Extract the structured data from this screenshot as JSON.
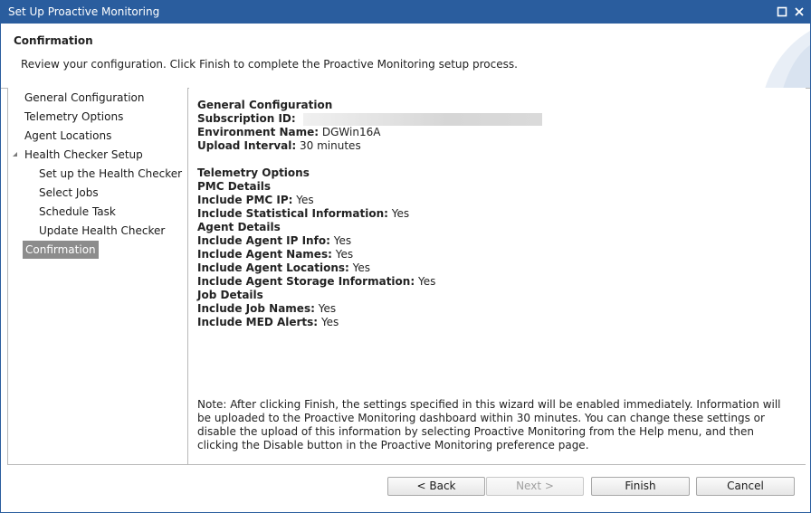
{
  "window": {
    "title": "Set Up Proactive Monitoring",
    "maximize_icon": "maximize-icon",
    "close_icon": "close-icon"
  },
  "header": {
    "heading": "Confirmation",
    "description": "Review your configuration. Click Finish to complete the Proactive Monitoring setup process."
  },
  "nav": {
    "items": [
      {
        "label": "General Configuration"
      },
      {
        "label": "Telemetry Options"
      },
      {
        "label": "Agent Locations"
      },
      {
        "label": "Health Checker Setup"
      },
      {
        "label": "Set up the Health Checker"
      },
      {
        "label": "Select Jobs"
      },
      {
        "label": "Schedule Task"
      },
      {
        "label": "Update Health Checker"
      },
      {
        "label": "Confirmation"
      }
    ],
    "expand_icon": "tree-expanded-arrow-icon"
  },
  "summary": {
    "general_heading": "General Configuration",
    "subscription_label": "Subscription ID:",
    "subscription_value": "",
    "environment_label": "Environment Name:",
    "environment_value": "DGWin16A",
    "upload_label": "Upload Interval:",
    "upload_value": "30 minutes",
    "telemetry_heading": "Telemetry Options",
    "pmc_heading": "PMC Details",
    "pmc_ip_label": "Include PMC IP:",
    "pmc_ip_value": "Yes",
    "stat_label": "Include Statistical Information:",
    "stat_value": "Yes",
    "agent_heading": "Agent Details",
    "agent_ip_label": "Include Agent IP Info:",
    "agent_ip_value": "Yes",
    "agent_names_label": "Include Agent Names:",
    "agent_names_value": "Yes",
    "agent_locations_label": "Include Agent Locations:",
    "agent_locations_value": "Yes",
    "agent_storage_label": "Include Agent Storage Information:",
    "agent_storage_value": "Yes",
    "job_heading": "Job Details",
    "job_names_label": "Include Job Names:",
    "job_names_value": "Yes",
    "med_alerts_label": "Include MED Alerts:",
    "med_alerts_value": "Yes"
  },
  "note": {
    "lines": [
      "Note: After clicking Finish, the settings specified in this wizard will be enabled immediately. Information will",
      "be uploaded to the Proactive Monitoring dashboard within 30 minutes. You can change these settings or",
      "disable the upload of this information by selecting Proactive Monitoring from the Help menu, and then",
      "clicking the Disable button in the Proactive Monitoring preference page."
    ]
  },
  "buttons": {
    "back": "< Back",
    "next": "Next >",
    "finish": "Finish",
    "cancel": "Cancel"
  },
  "colors": {
    "titlebar": "#2a5d9e",
    "selected_nav": "#8c8c8c"
  }
}
